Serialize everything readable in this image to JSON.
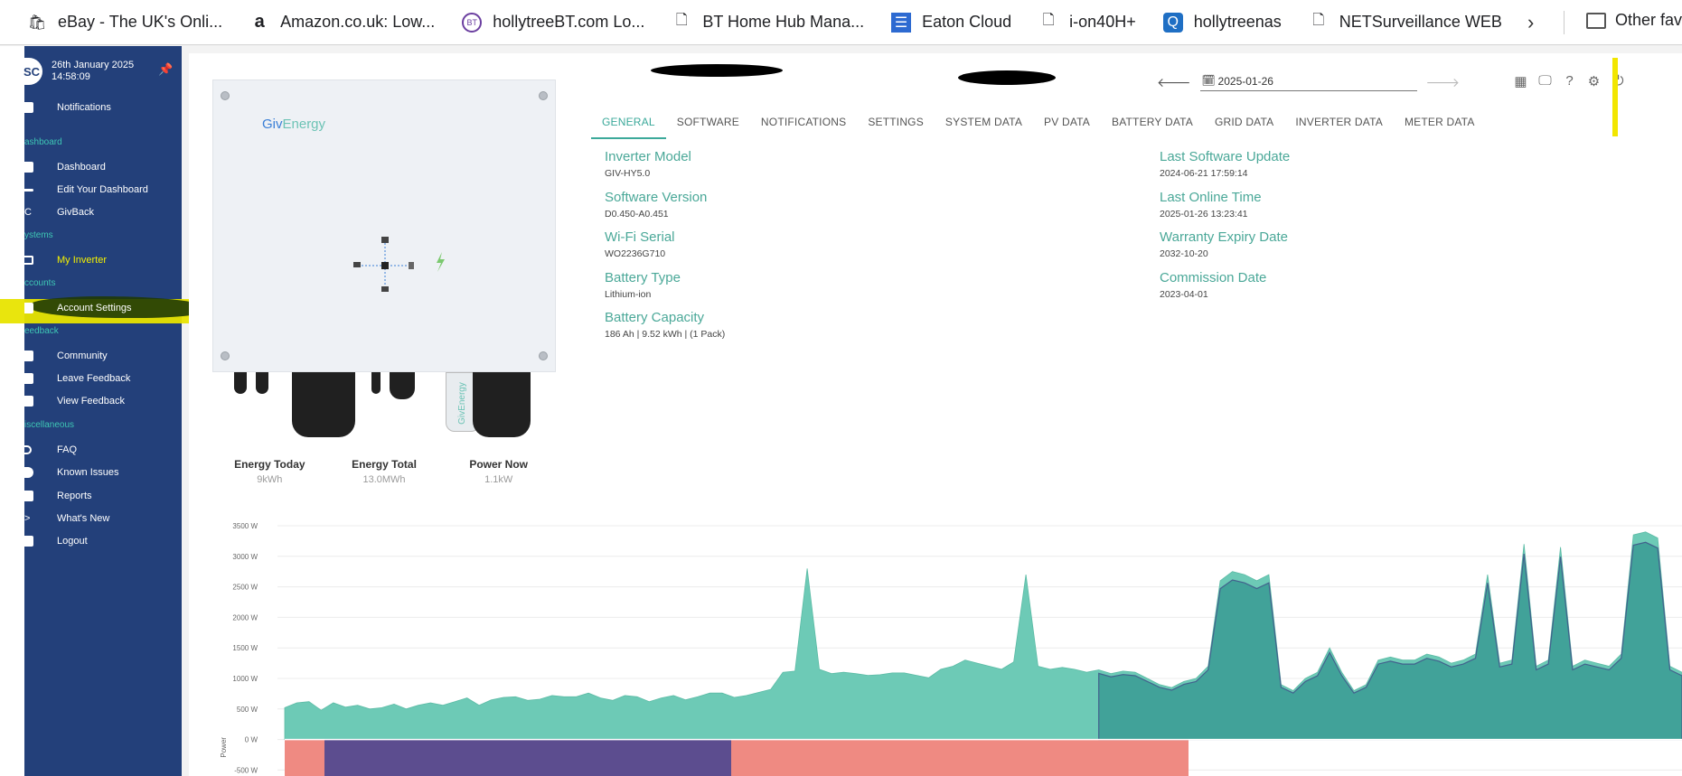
{
  "bookmarks": [
    {
      "label": "eBay - The UK's Onli...",
      "icon": "ebay-bag-icon"
    },
    {
      "label": "Amazon.co.uk: Low...",
      "icon": "amazon-icon"
    },
    {
      "label": "hollytreeBT.com Lo...",
      "icon": "bt-icon"
    },
    {
      "label": "BT Home Hub Mana...",
      "icon": "page-icon"
    },
    {
      "label": "Eaton Cloud",
      "icon": "server-icon"
    },
    {
      "label": "i-on40H+",
      "icon": "page-icon"
    },
    {
      "label": "hollytreenas",
      "icon": "nas-icon"
    },
    {
      "label": "NETSurveillance WEB",
      "icon": "page-icon"
    }
  ],
  "bookmarks_other": "Other fav",
  "sidebar": {
    "avatar": "SC",
    "date": "26th January 2025",
    "time": "14:58:09",
    "notifications": "Notifications",
    "sections": {
      "dashboard": "ashboard",
      "systems": "ystems",
      "accounts": "ccounts",
      "feedback": "eedback",
      "misc": "iscellaneous"
    },
    "items": {
      "dashboard": "Dashboard",
      "edit_dashboard": "Edit Your Dashboard",
      "givback": "GivBack",
      "my_inverter": "My Inverter",
      "account_settings": "Account Settings",
      "community": "Community",
      "leave_feedback": "Leave Feedback",
      "view_feedback": "View Feedback",
      "faq": "FAQ",
      "known_issues": "Known Issues",
      "reports": "Reports",
      "whats_new": "What's New",
      "logout": "Logout"
    }
  },
  "inverter": {
    "brand_a": "Giv",
    "brand_b": "Energy",
    "dongle_text": "GivEnergy"
  },
  "stats": [
    {
      "label": "Energy Today",
      "value": "9kWh"
    },
    {
      "label": "Energy Total",
      "value": "13.0MWh"
    },
    {
      "label": "Power Now",
      "value": "1.1kW"
    }
  ],
  "date": "2025-01-26",
  "tabs": [
    "GENERAL",
    "SOFTWARE",
    "NOTIFICATIONS",
    "SETTINGS",
    "SYSTEM DATA",
    "PV DATA",
    "BATTERY DATA",
    "GRID DATA",
    "INVERTER DATA",
    "METER DATA"
  ],
  "info_left": [
    {
      "label": "Inverter Model",
      "value": "GIV-HY5.0"
    },
    {
      "label": "Software Version",
      "value": "D0.450-A0.451"
    },
    {
      "label": "Wi-Fi Serial",
      "value": "WO2236G710"
    },
    {
      "label": "Battery Type",
      "value": "Lithium-ion"
    },
    {
      "label": "Battery Capacity",
      "value": "186 Ah | 9.52 kWh | (1 Pack)"
    }
  ],
  "info_right": [
    {
      "label": "Last Software Update",
      "value": "2024-06-21 17:59:14"
    },
    {
      "label": "Last Online Time",
      "value": "2025-01-26 13:23:41"
    },
    {
      "label": "Warranty Expiry Date",
      "value": "2032-10-20"
    },
    {
      "label": "Commission Date",
      "value": "2023-04-01"
    }
  ],
  "chart_data": {
    "type": "area",
    "ylabel": "Power",
    "yticks": [
      "3500 W",
      "3000 W",
      "2500 W",
      "2000 W",
      "1500 W",
      "1000 W",
      "500 W",
      "0 W",
      "-500 W"
    ],
    "ylim": [
      -500,
      3500
    ],
    "colors": {
      "load": "#6dcab6",
      "pv": "#3a9c94",
      "grid": "#3b4f86",
      "battery_charge": "#ef8a82",
      "battery_night": "#5c4d8f"
    },
    "series": [
      {
        "values": [
          520,
          600,
          620,
          480,
          600,
          530,
          560,
          500,
          520,
          580,
          500,
          560,
          600,
          560,
          620,
          680,
          560,
          650,
          690,
          700,
          640,
          660,
          720,
          700,
          700,
          760,
          680,
          640,
          720,
          700,
          620,
          680,
          720,
          650,
          700,
          760,
          760,
          690,
          720,
          770,
          820,
          1100,
          1120,
          2800,
          1150,
          1080,
          1100,
          1080,
          1050,
          1060,
          1090,
          1090,
          1050,
          1010,
          1150,
          1200,
          1300,
          1250,
          1200,
          1150,
          1270,
          2700,
          1200,
          1150,
          1180,
          1150,
          1100,
          1140,
          1080,
          1120,
          1100,
          1000,
          900,
          850,
          950,
          1000,
          1200,
          2600,
          2750,
          2700,
          2600,
          2700,
          900,
          800,
          1000,
          1100,
          1500,
          1100,
          800,
          900,
          1300,
          1350,
          1300,
          1300,
          1400,
          1350,
          1250,
          1300,
          1400,
          2700,
          1250,
          1300,
          3200,
          1200,
          1300,
          3150,
          1200,
          1300,
          1250,
          1200,
          1400,
          3350,
          3400,
          3300,
          1200,
          1100
        ]
      }
    ]
  }
}
